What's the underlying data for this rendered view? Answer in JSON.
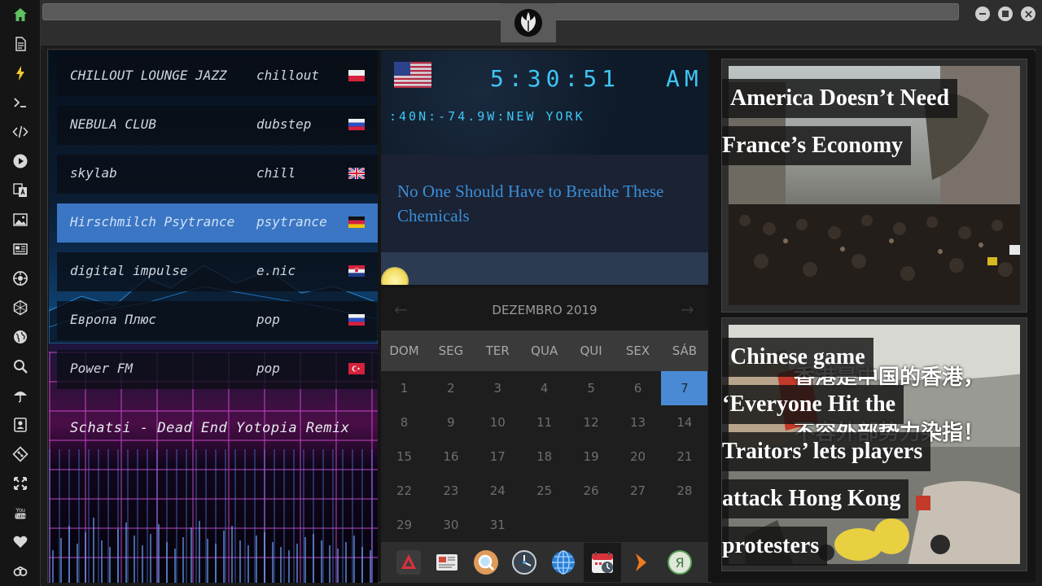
{
  "dock": {
    "items": [
      "home-icon",
      "document-icon",
      "lightning-icon",
      "terminal-icon",
      "code-icon",
      "play-icon",
      "translate-icon",
      "image-icon",
      "news-icon",
      "compass-icon",
      "hexagon-icon",
      "globe-icon",
      "search-icon",
      "umbrella-icon",
      "contact-icon",
      "git-icon",
      "fullscreen-icon",
      "youtube-icon",
      "heart-icon",
      "cloud-link-icon"
    ],
    "youtube_label": "You Tube"
  },
  "radio": {
    "stations": [
      {
        "name": "CHILLOUT LOUNGE JAZZ",
        "genre": "chillout",
        "flag": "poland"
      },
      {
        "name": "NEBULA CLUB",
        "genre": "dubstep",
        "flag": "russia"
      },
      {
        "name": "skylab",
        "genre": "chill",
        "flag": "uk"
      },
      {
        "name": "Hirschmilch Psytrance",
        "genre": "psytrance",
        "flag": "germany"
      },
      {
        "name": "digital impulse",
        "genre": "e.nic",
        "flag": "croatia"
      },
      {
        "name": "Европа Плюс",
        "genre": "pop",
        "flag": "russia"
      },
      {
        "name": "Power FM",
        "genre": "pop",
        "flag": "turkey"
      }
    ],
    "active_index": 3,
    "now_playing": "Schatsi - Dead End Yotopia Remix"
  },
  "clock": {
    "time": "5:30:51",
    "ampm": "AM",
    "location": ":40N:-74.9W:NEW YORK",
    "accent": "#3fc6f5"
  },
  "headline": {
    "text": "No One Should Have to Breathe These Chemicals"
  },
  "calendar": {
    "title": "DEZEMBRO 2019",
    "prev": "←",
    "next": "→",
    "day_names": [
      "DOM",
      "SEG",
      "TER",
      "QUA",
      "QUI",
      "SEX",
      "SÁB"
    ],
    "days": [
      1,
      2,
      3,
      4,
      5,
      6,
      7,
      8,
      9,
      10,
      11,
      12,
      13,
      14,
      15,
      16,
      17,
      18,
      19,
      20,
      21,
      22,
      23,
      24,
      25,
      26,
      27,
      28,
      29,
      30,
      31
    ],
    "first_weekday": 0,
    "today": 7,
    "today_color": "#4a8ad4"
  },
  "apps": [
    "app-launcher-icon",
    "newspaper-icon",
    "search-app-icon",
    "clock-icon",
    "globe-icon",
    "calendar-icon",
    "forward-icon",
    "yandex-icon"
  ],
  "app_yandex_letter": "Я",
  "news": {
    "cards": [
      {
        "lines": [
          "America Doesn’t Need",
          "France’s Economy"
        ]
      },
      {
        "lines": [
          "Chinese game",
          "‘Everyone Hit the",
          "Traitors’ lets players",
          "attack Hong Kong",
          "protesters"
        ]
      }
    ],
    "card2_sign_text": "香港是中国的香港，",
    "card2_sign_text2": "不容外部势力染指！"
  }
}
